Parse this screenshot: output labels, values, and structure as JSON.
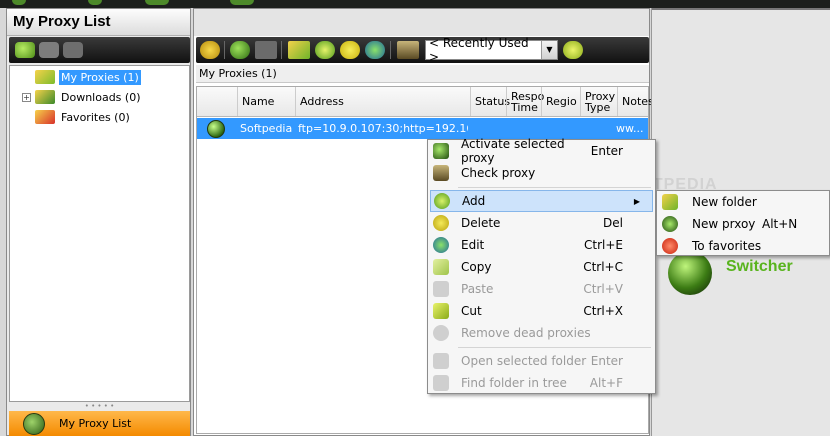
{
  "colors": {
    "accent": "#3399ff",
    "footer": "#f7a21b",
    "brand_green": "#59b41e",
    "toolbar_dark": "#1d1d1d"
  },
  "left_panel": {
    "title": "My Proxy List",
    "toolbar_icons": [
      "add-folder-icon",
      "rename-folder-icon",
      "delete-folder-icon"
    ],
    "tree": [
      {
        "label": "My Proxies (1)",
        "selected": true,
        "expandable": false,
        "icon": "folder-globe-icon"
      },
      {
        "label": "Downloads (0)",
        "selected": false,
        "expandable": true,
        "icon": "download-folder-icon"
      },
      {
        "label": "Favorites (0)",
        "selected": false,
        "expandable": false,
        "icon": "favorites-folder-icon"
      }
    ],
    "footer_label": "My Proxy List"
  },
  "toolbar": {
    "icons": [
      "undo-icon",
      "play-icon",
      "delete-icon",
      "new-folder-icon",
      "add-proxy-icon",
      "remove-icon",
      "edit-icon",
      "tools-icon",
      "chat-icon"
    ],
    "recent_combo": "< Recently Used >"
  },
  "breadcrumb": "My Proxies (1)",
  "grid": {
    "columns": [
      "",
      "Name",
      "Address",
      "Status",
      "Respo Time",
      "Regio",
      "Proxy Type",
      "Notes"
    ],
    "rows": [
      {
        "name": "Softpedia",
        "address": "ftp=10.9.0.107:30;http=192.168....",
        "status": "",
        "response_time": "",
        "region": "",
        "proxy_type": "",
        "notes": "ww...",
        "selected": true
      }
    ]
  },
  "context_menu": {
    "items": [
      {
        "label": "Activate selected proxy",
        "shortcut": "Enter",
        "icon": "activate-icon",
        "disabled": false
      },
      {
        "label": "Check proxy",
        "shortcut": "",
        "icon": "check-proxy-icon",
        "disabled": false
      },
      {
        "label": "Add",
        "shortcut": "",
        "icon": "add-icon",
        "disabled": false,
        "highlighted": true,
        "submenu": true
      },
      {
        "label": "Delete",
        "shortcut": "Del",
        "icon": "delete-icon",
        "disabled": false
      },
      {
        "label": "Edit",
        "shortcut": "Ctrl+E",
        "icon": "edit-icon",
        "disabled": false
      },
      {
        "label": "Copy",
        "shortcut": "Ctrl+C",
        "icon": "copy-icon",
        "disabled": false
      },
      {
        "label": "Paste",
        "shortcut": "Ctrl+V",
        "icon": "paste-icon",
        "disabled": true
      },
      {
        "label": "Cut",
        "shortcut": "Ctrl+X",
        "icon": "cut-icon",
        "disabled": false
      },
      {
        "label": "Remove dead proxies",
        "shortcut": "",
        "icon": "remove-dead-icon",
        "disabled": true
      },
      {
        "label": "Open selected folder",
        "shortcut": "Enter",
        "icon": "open-folder-icon",
        "disabled": true
      },
      {
        "label": "Find folder in tree",
        "shortcut": "Alt+F",
        "icon": "find-folder-icon",
        "disabled": true
      }
    ]
  },
  "submenu": {
    "items": [
      {
        "label": "New folder",
        "shortcut": "",
        "icon": "new-folder-icon"
      },
      {
        "label": "New prxoy",
        "shortcut": "Alt+N",
        "icon": "new-proxy-icon"
      },
      {
        "label": "To favorites",
        "shortcut": "",
        "icon": "favorites-icon"
      }
    ]
  },
  "watermark": "SOFTPEDIA",
  "brand": {
    "logo_text": "Switcher"
  }
}
